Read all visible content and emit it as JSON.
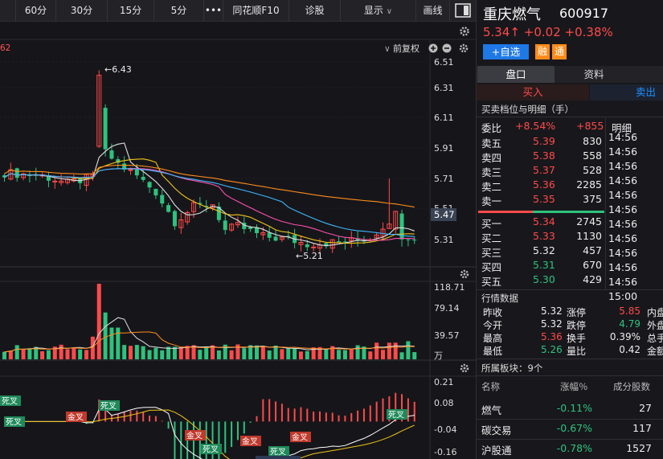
{
  "toolbar": {
    "periods": [
      "60分",
      "30分",
      "15分",
      "5分"
    ],
    "more": "•••",
    "f10": "同花顺F10",
    "diagnose": "诊股",
    "display": "显示",
    "draw": "画线"
  },
  "chart_header": {
    "left_value": "62",
    "rights_label": "前复权"
  },
  "price_axis": [
    "6.51",
    "6.31",
    "6.11",
    "5.91",
    "5.71",
    "5.51",
    "5.31"
  ],
  "current_price_tag": "5.47",
  "annotations": {
    "high": "←6.43",
    "low": "←5.21"
  },
  "volume_axis": [
    "118.71",
    "79.14",
    "39.57",
    "万"
  ],
  "macd_axis": [
    "0.21",
    "0.08",
    "-0.04",
    "-0.16"
  ],
  "macd_labels": [
    "死叉",
    "死叉",
    "金叉",
    "死叉",
    "金叉",
    "死叉",
    "金叉",
    "死叉",
    "金叉",
    "死叉"
  ],
  "stock": {
    "name": "重庆燃气",
    "code": "600917",
    "price": "5.34",
    "arrow": "↑",
    "change": "+0.02",
    "pct": "+0.38%",
    "add_btn": "+自选",
    "tag_rong": "融",
    "tag_tong": "通"
  },
  "tabs": [
    "盘口",
    "资料"
  ],
  "trade": {
    "buy": "买入",
    "sell": "卖出"
  },
  "orderbook": {
    "title": "买卖档位与明细（手）",
    "ratio_label": "委比",
    "ratio": "+8.54%",
    "diff": "+855",
    "detail_label": "明细",
    "asks": [
      {
        "label": "卖五",
        "price": "5.39",
        "vol": "830"
      },
      {
        "label": "卖四",
        "price": "5.38",
        "vol": "558"
      },
      {
        "label": "卖三",
        "price": "5.37",
        "vol": "528"
      },
      {
        "label": "卖二",
        "price": "5.36",
        "vol": "2285"
      },
      {
        "label": "卖一",
        "price": "5.35",
        "vol": "375"
      }
    ],
    "bids": [
      {
        "label": "买一",
        "price": "5.34",
        "vol": "2745"
      },
      {
        "label": "买二",
        "price": "5.33",
        "vol": "1130"
      },
      {
        "label": "买三",
        "price": "5.32",
        "vol": "457"
      },
      {
        "label": "买四",
        "price": "5.31",
        "vol": "670"
      },
      {
        "label": "买五",
        "price": "5.30",
        "vol": "429"
      }
    ],
    "times": [
      "14:56",
      "14:56",
      "14:56",
      "14:56",
      "14:56",
      "14:56",
      "14:56",
      "14:56",
      "14:56",
      "14:56",
      "14:56",
      "15:00"
    ]
  },
  "quote": {
    "title": "行情数据",
    "rows": [
      [
        {
          "l": "昨收",
          "v": "5.32"
        },
        {
          "l": "涨停",
          "v": "5.85"
        },
        {
          "l": "内盘"
        }
      ],
      [
        {
          "l": "今开",
          "v": "5.32"
        },
        {
          "l": "跌停",
          "v": "4.79"
        },
        {
          "l": "外盘"
        }
      ],
      [
        {
          "l": "最高",
          "v": "5.36"
        },
        {
          "l": "换手",
          "v": "0.39%"
        },
        {
          "l": "总手"
        }
      ],
      [
        {
          "l": "最低",
          "v": "5.26"
        },
        {
          "l": "量比",
          "v": "0.42"
        },
        {
          "l": "金额"
        }
      ]
    ]
  },
  "sectors": {
    "title": "所属板块：9个",
    "headers": [
      "名称",
      "涨幅％",
      "成分股数"
    ],
    "rows": [
      {
        "name": "燃气",
        "chg": "-0.11%",
        "count": "27"
      },
      {
        "name": "碳交易",
        "chg": "-0.67%",
        "count": "117"
      },
      {
        "name": "沪股通",
        "chg": "-0.78%",
        "count": "1527"
      }
    ]
  },
  "colors": {
    "up": "#ff4a4a",
    "down": "#2ec27e",
    "accent": "#1e90ff",
    "orange": "#ff8c1a"
  }
}
